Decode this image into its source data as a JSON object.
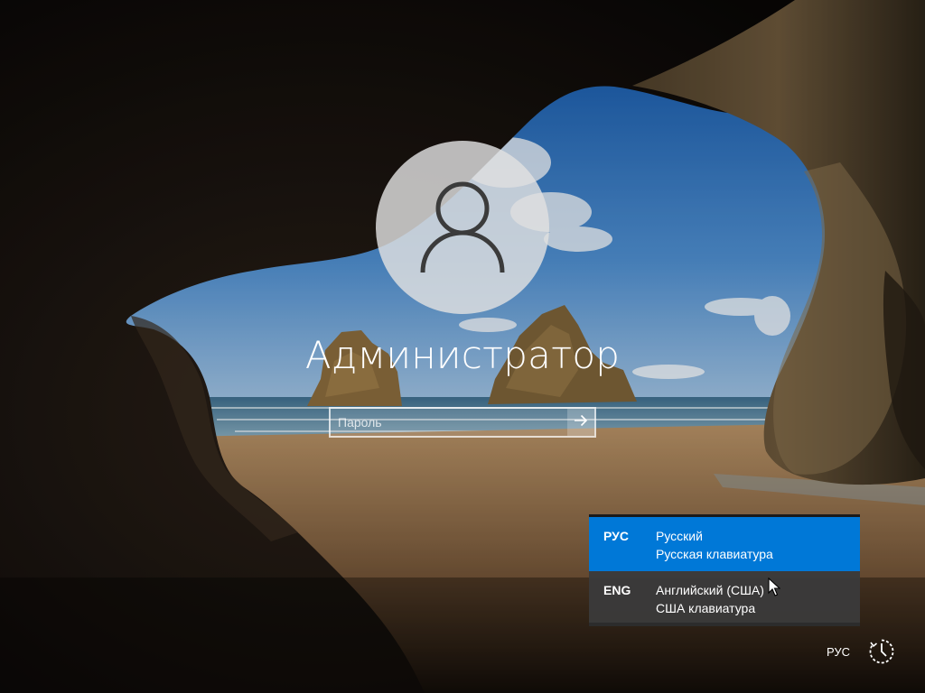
{
  "user": {
    "name": "Администратор",
    "avatar_icon": "user-icon"
  },
  "login": {
    "password_placeholder": "Пароль",
    "password_value": "",
    "submit_icon": "arrow-right-icon"
  },
  "language_menu": {
    "items": [
      {
        "code": "РУС",
        "language": "Русский",
        "keyboard": "Русская клавиатура",
        "selected": true
      },
      {
        "code": "ENG",
        "language": "Английский (США)",
        "keyboard": "США клавиатура",
        "selected": false
      }
    ]
  },
  "taskbar": {
    "language_indicator": "РУС",
    "accessibility_icon": "ease-of-access-icon"
  },
  "colors": {
    "selected_item": "#0078d7",
    "menu_background": "#3a3a3a",
    "text": "#ffffff"
  }
}
